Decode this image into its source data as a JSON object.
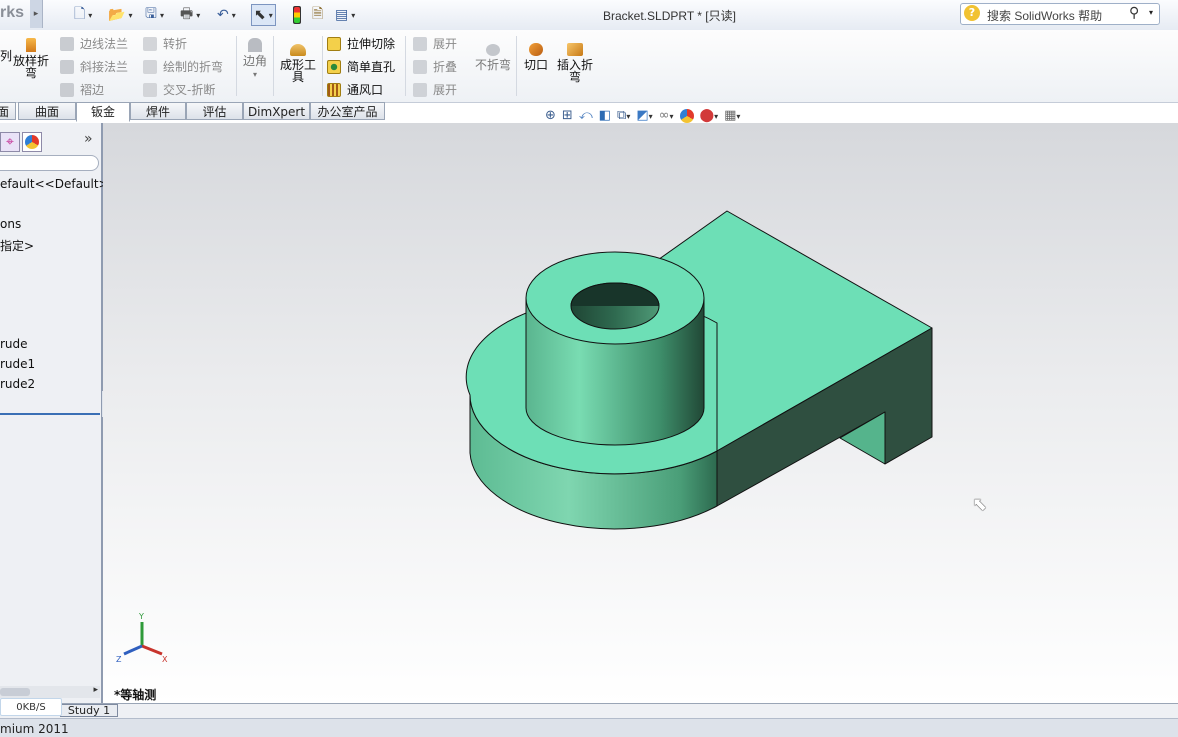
{
  "app": {
    "brand": "rks",
    "document_title": "Bracket.SLDPRT * [只读]",
    "colors": {
      "accent": "#3a6fb5",
      "model": "#6ddfb6"
    }
  },
  "search": {
    "placeholder": "搜索 SolidWorks 帮助"
  },
  "ribbon": {
    "left_cut": {
      "label_top": "放样折",
      "label_bottom": "弯",
      "label_partial": "列"
    },
    "group1": [
      "边线法兰",
      "斜接法兰",
      "褶边"
    ],
    "group2": [
      "转折",
      "绘制的折弯",
      "交叉-折断"
    ],
    "corner": {
      "label": "边角"
    },
    "forming": {
      "label_top": "成形工",
      "label_bottom": "具"
    },
    "group3": [
      "拉伸切除",
      "简单直孔",
      "通风口"
    ],
    "group4": [
      "展开",
      "折叠",
      "展开"
    ],
    "no_bend": "不折弯",
    "cut": "切口",
    "insert_bend": {
      "label_top": "插入折",
      "label_bottom": "弯"
    }
  },
  "tabs": [
    "面",
    "曲面",
    "钣金",
    "焊件",
    "评估",
    "DimXpert",
    "办公室产品"
  ],
  "tree": {
    "config": "efault<<Default>_",
    "items": [
      "ons",
      "指定>",
      "rude",
      "rude1",
      "rude2"
    ]
  },
  "viewport": {
    "view_label": "*等轴测",
    "triad": {
      "x": "X",
      "y": "Y",
      "z": "Z"
    }
  },
  "bottom": {
    "study_tab": "Study 1",
    "speed": "0KB/S"
  },
  "status": {
    "text": "mium 2011"
  }
}
